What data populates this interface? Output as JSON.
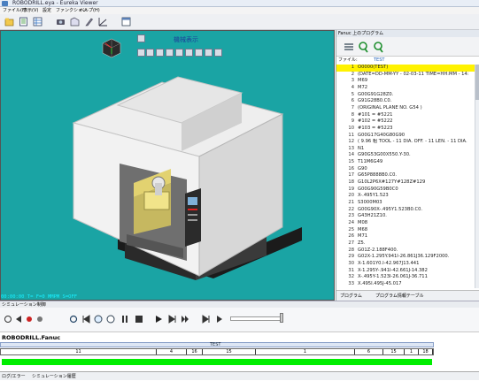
{
  "window": {
    "title": "ROBODRILL.eya - Eureka Viewer"
  },
  "menu": [
    "ファイル(F)",
    "表示(V)",
    "設定",
    "ファンクション",
    "ヘルプ(H)"
  ],
  "toolbar_icons": [
    "open-icon",
    "list-icon",
    "table-icon",
    "camera-icon",
    "machine-icon",
    "tool-icon",
    "chart-icon",
    "window-icon"
  ],
  "viewport": {
    "title": "機械表示",
    "status": "00:00:00          T=   F=0 MMPM    S=OFF",
    "background": "#1aa4a4"
  },
  "right_panel": {
    "header": "Fanuc 上のプログラム",
    "file_label": "ファイル:",
    "file_name": "TEST",
    "highlight_color": "#fff200",
    "lines": [
      {
        "n": "1",
        "t": "O0000(TEST)"
      },
      {
        "n": "2",
        "t": "(DATE=DD-MM-YY - 02-03-11 TIME=HH:MM - 14:"
      },
      {
        "n": "3",
        "t": "M69"
      },
      {
        "n": "4",
        "t": "M72"
      },
      {
        "n": "5",
        "t": "G00G91G28Z0."
      },
      {
        "n": "6",
        "t": "G91G28B0.C0."
      },
      {
        "n": "7",
        "t": "(ORIGINAL PLANE NO. G54 )"
      },
      {
        "n": "8",
        "t": "#101 = #5221"
      },
      {
        "n": "9",
        "t": "#102 = #5222"
      },
      {
        "n": "10",
        "t": "#103 = #5223"
      },
      {
        "n": "11",
        "t": "G00G17G40G80G90"
      },
      {
        "n": "12",
        "t": "( 9.96 粗 TOOL - 11 DIA. OFF. - 11 LEN. - 11 DIA."
      },
      {
        "n": "13",
        "t": "N1"
      },
      {
        "n": "14",
        "t": "G90G53G00X550.Y-30."
      },
      {
        "n": "15",
        "t": "T11M6G49"
      },
      {
        "n": "16",
        "t": "G90"
      },
      {
        "n": "17",
        "t": "G65P8888B0.C0."
      },
      {
        "n": "18",
        "t": "G10L2P6X#127Y#128Z#129"
      },
      {
        "n": "19",
        "t": "G00G90G59B0C0"
      },
      {
        "n": "20",
        "t": "X-.495Y1.523"
      },
      {
        "n": "21",
        "t": "S3000M03"
      },
      {
        "n": "22",
        "t": "G00G90X-.495Y1.523B0.C0."
      },
      {
        "n": "23",
        "t": "G43H21Z10."
      },
      {
        "n": "24",
        "t": "M08"
      },
      {
        "n": "25",
        "t": "M68"
      },
      {
        "n": "26",
        "t": "M71"
      },
      {
        "n": "27",
        "t": "Z5."
      },
      {
        "n": "28",
        "t": "G01Z-2.188F400."
      },
      {
        "n": "29",
        "t": "G02X-1.295Y.941I-26.861J36.129F2000."
      },
      {
        "n": "30",
        "t": "X-1.601Y0.I-42.967J13.441"
      },
      {
        "n": "31",
        "t": "X-1.295Y-.941I-42.661J-14.382"
      },
      {
        "n": "32",
        "t": "X-.495Y-1.523I-26.061J-36.711"
      },
      {
        "n": "33",
        "t": "X.495I.495J-45.017"
      }
    ],
    "tabs": [
      "プログラム",
      "プログラム情報テーブル"
    ]
  },
  "sim": {
    "label": "シミュレーション制御",
    "program": "ROBODRILL.Fanuc",
    "ruler_label": "TEST",
    "segments": [
      {
        "label": "11"
      },
      {
        "label": "4"
      },
      {
        "label": "16"
      },
      {
        "label": "15"
      },
      {
        "label": "1"
      },
      {
        "label": "6"
      },
      {
        "label": "15"
      },
      {
        "label": "1"
      },
      {
        "label": "18"
      }
    ],
    "progress_color": "#00ee00"
  },
  "bottom_tabs": [
    "ログ/エラー",
    "シミュレーション履歴"
  ]
}
